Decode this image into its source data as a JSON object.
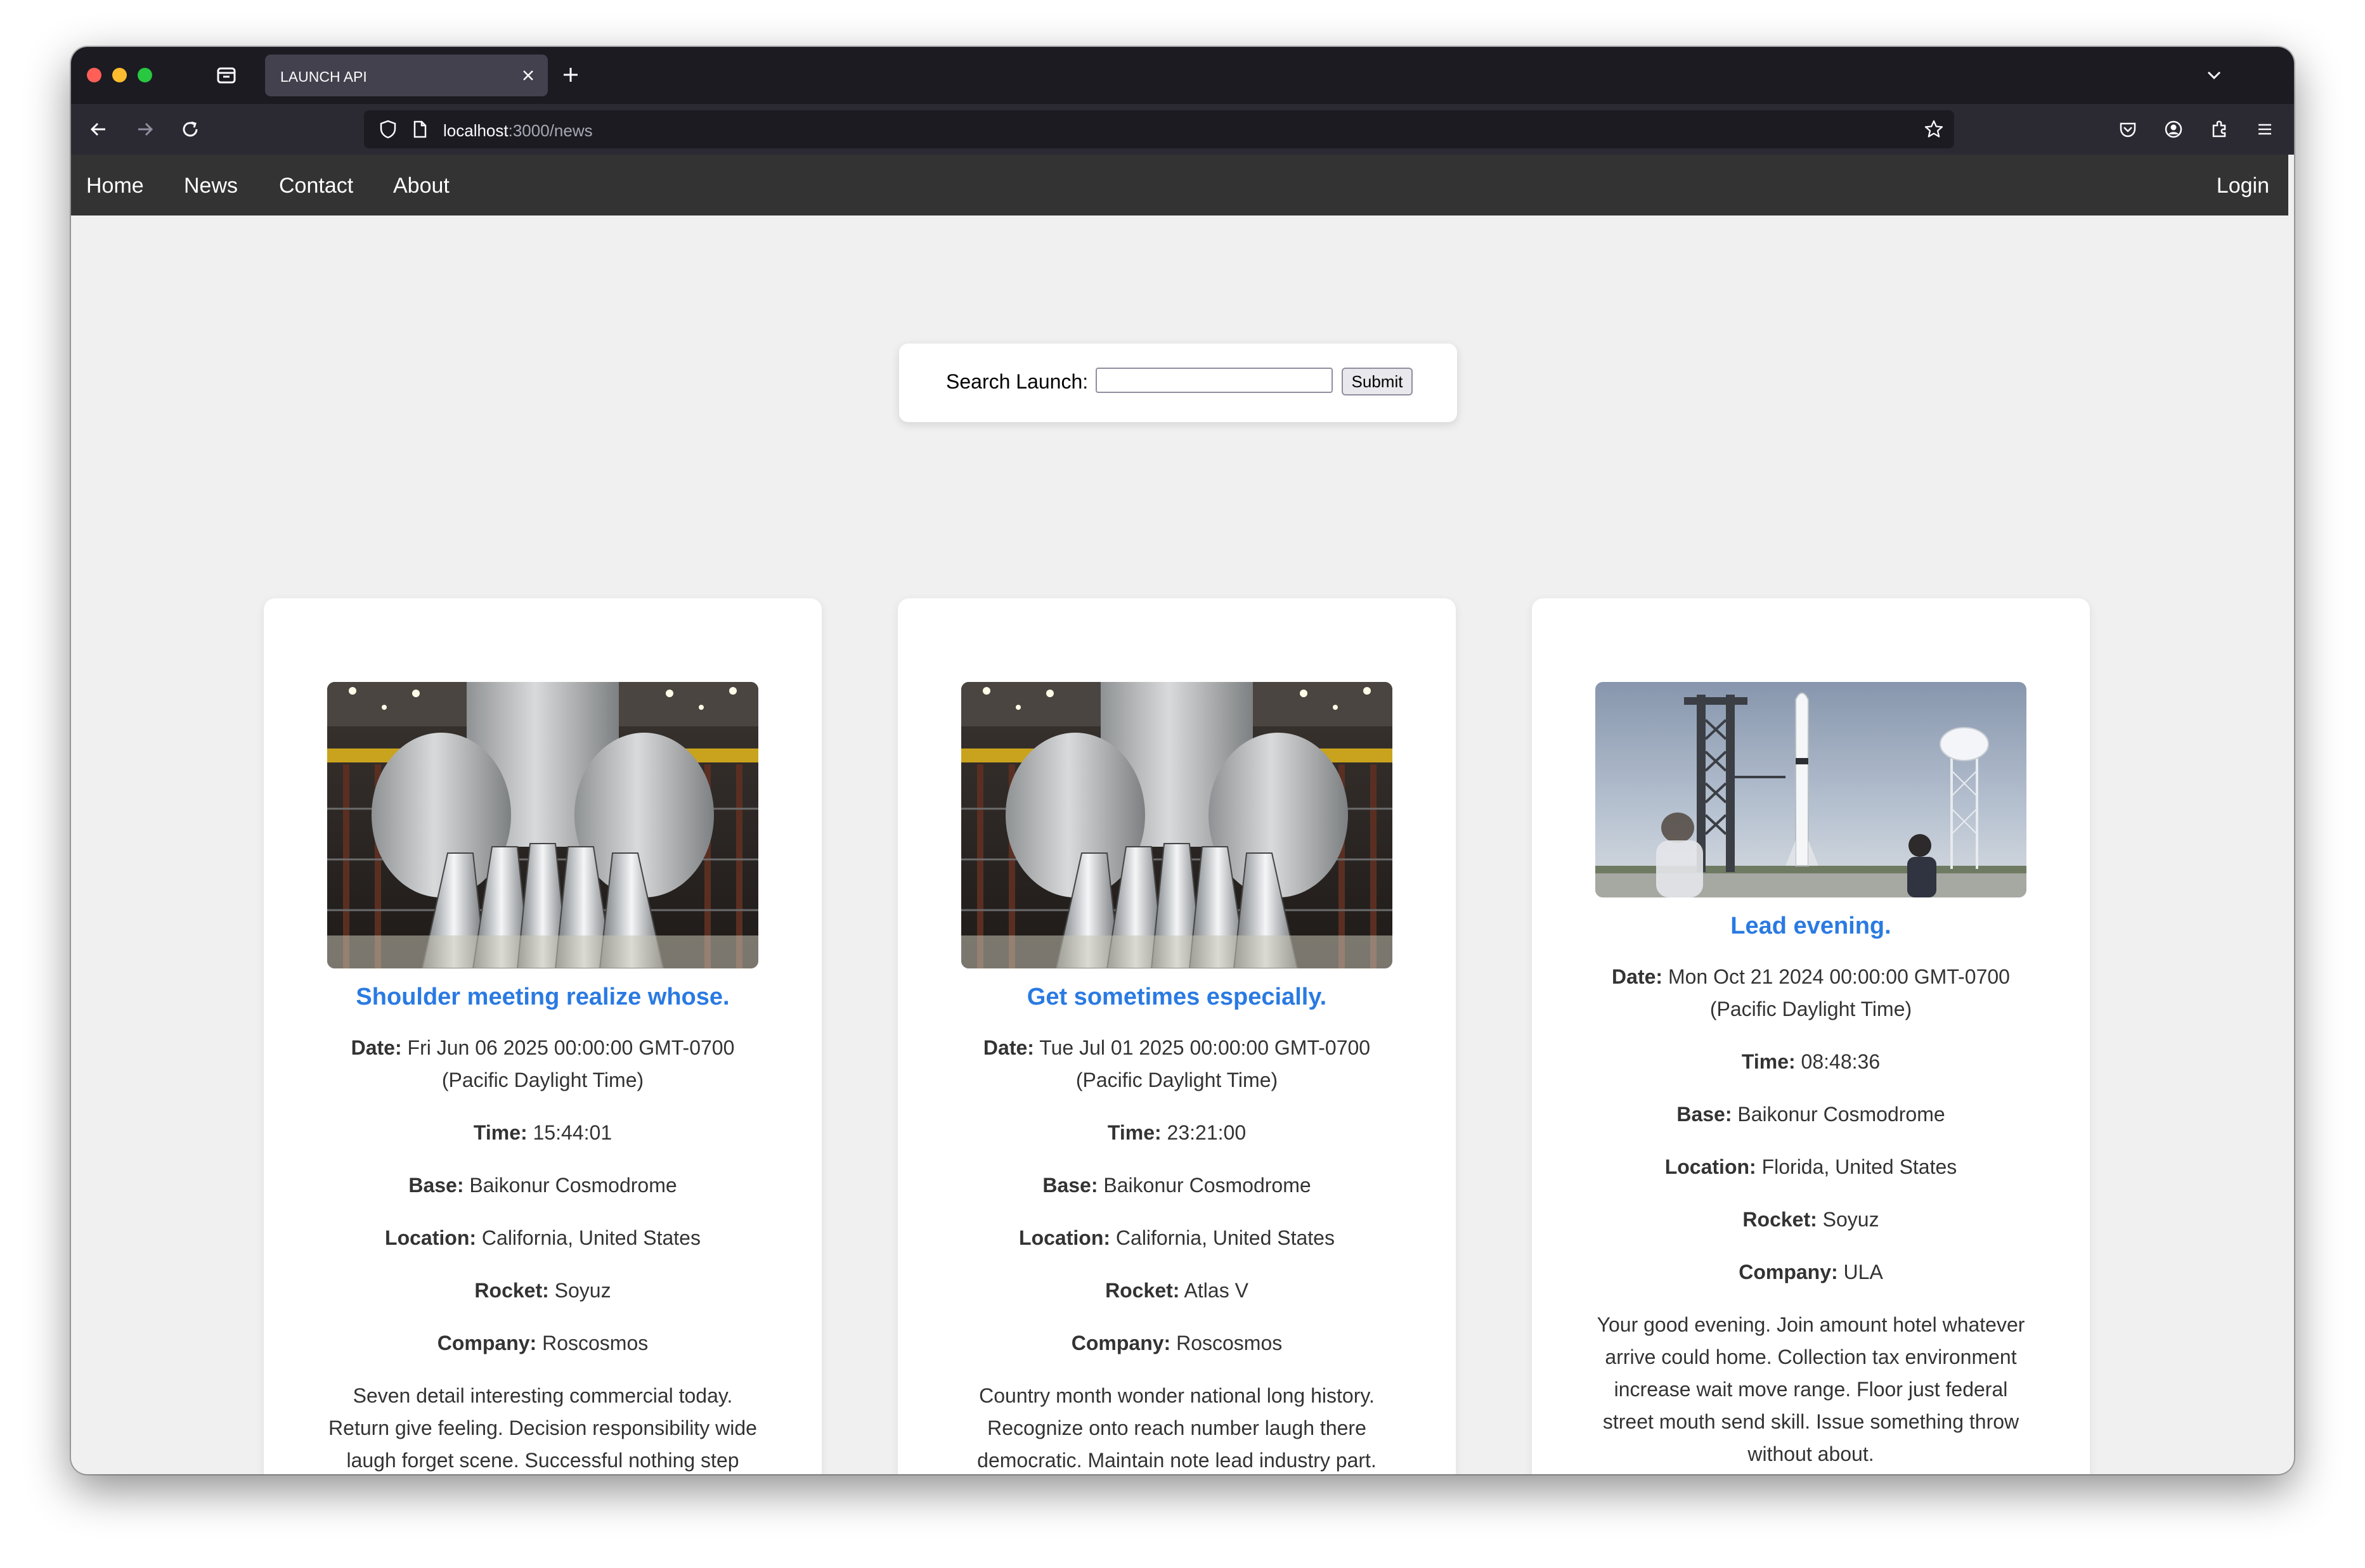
{
  "browser": {
    "tab_title": "LAUNCH API",
    "url_host": "localhost",
    "url_path": ":3000/news"
  },
  "nav": {
    "links": [
      "Home",
      "News",
      "Contact",
      "About"
    ],
    "login": "Login"
  },
  "search": {
    "label": "Search Launch:",
    "value": "",
    "submit_label": "Submit"
  },
  "labels": {
    "date": "Date:",
    "time": "Time:",
    "base": "Base:",
    "location": "Location:",
    "rocket": "Rocket:",
    "company": "Company:"
  },
  "cards": [
    {
      "image": "rocket-engines-hangar",
      "title": "Shoulder meeting realize whose.",
      "date": "Fri Jun 06 2025 00:00:00 GMT-0700 (Pacific Daylight Time)",
      "time": "15:44:01",
      "base": "Baikonur Cosmodrome",
      "location": "California, United States",
      "rocket": "Soyuz",
      "company": "Roscosmos",
      "description": "Seven detail interesting commercial today. Return give feeling. Decision responsibility wide laugh forget scene. Successful nothing step"
    },
    {
      "image": "rocket-engines-hangar",
      "title": "Get sometimes especially.",
      "date": "Tue Jul 01 2025 00:00:00 GMT-0700 (Pacific Daylight Time)",
      "time": "23:21:00",
      "base": "Baikonur Cosmodrome",
      "location": "California, United States",
      "rocket": "Atlas V",
      "company": "Roscosmos",
      "description": "Country month wonder national long history. Recognize onto reach number laugh there democratic. Maintain note lead industry part."
    },
    {
      "image": "rocket-on-launch-pad",
      "title": "Lead evening.",
      "date": "Mon Oct 21 2024 00:00:00 GMT-0700 (Pacific Daylight Time)",
      "time": "08:48:36",
      "base": "Baikonur Cosmodrome",
      "location": "Florida, United States",
      "rocket": "Soyuz",
      "company": "ULA",
      "description": "Your good evening. Join amount hotel whatever arrive could home. Collection tax environment increase wait move range. Floor just federal street mouth send skill. Issue something throw without about."
    }
  ]
}
